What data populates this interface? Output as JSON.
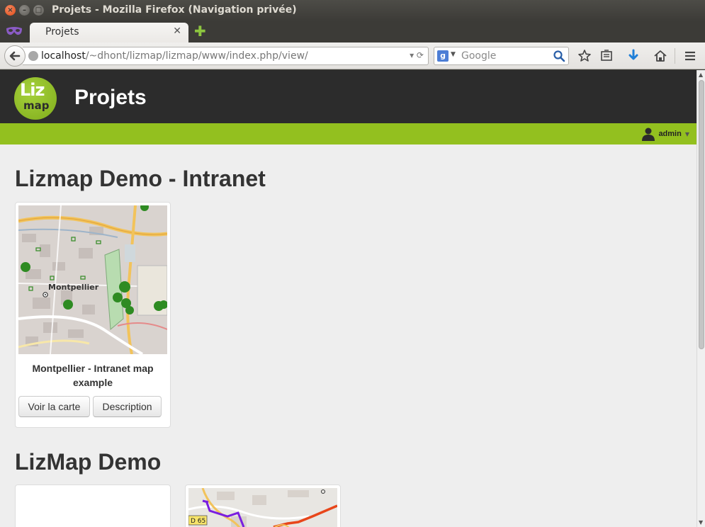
{
  "window": {
    "title": "Projets - Mozilla Firefox (Navigation privée)"
  },
  "tabs": [
    {
      "label": "Projets",
      "active": true
    }
  ],
  "navbar": {
    "url_host": "localhost",
    "url_path": "/~dhont/lizmap/lizmap/www/index.php/view/",
    "search_placeholder": "Google"
  },
  "site": {
    "logo_top": "Liz",
    "logo_bottom": "map",
    "title": "Projets",
    "user": "admin",
    "colors": {
      "header": "#2c2c2c",
      "accent": "#93c01f"
    }
  },
  "sections": [
    {
      "title": "Lizmap Demo - Intranet",
      "projects": [
        {
          "title": "Montpellier - Intranet map example",
          "map_label": "Montpellier",
          "view_label": "Voir la carte",
          "description_label": "Description"
        }
      ]
    },
    {
      "title": "LizMap Demo",
      "projects": [
        {
          "title": ""
        },
        {
          "title": "",
          "map_label": "D 65"
        }
      ]
    }
  ]
}
